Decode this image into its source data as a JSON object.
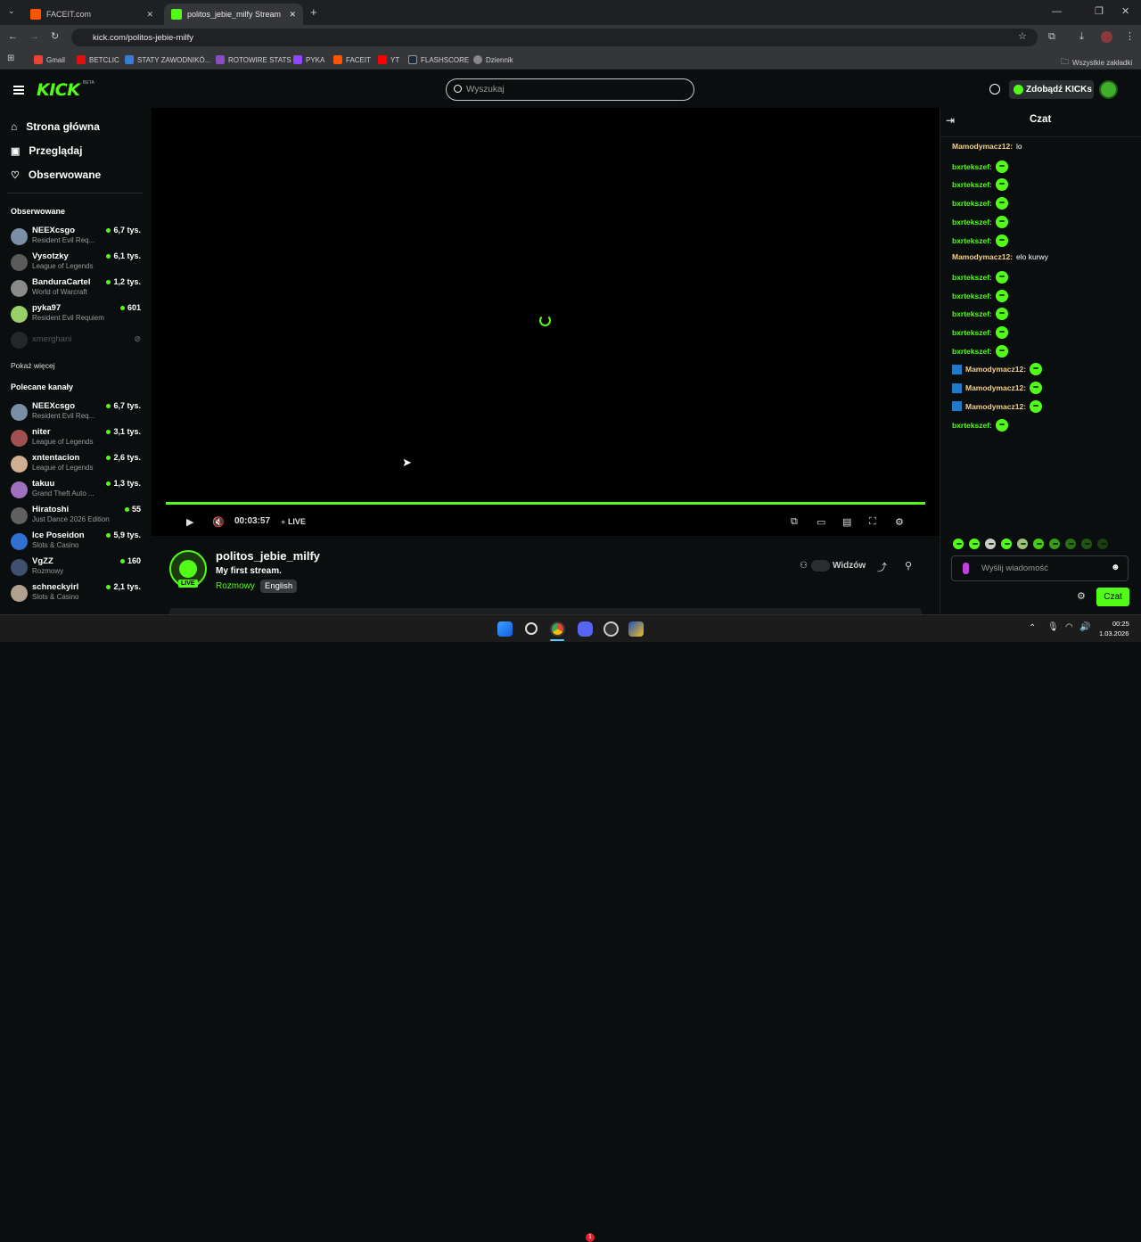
{
  "browser": {
    "tabs": [
      {
        "label": "FACEIT.com"
      },
      {
        "label": "politos_jebie_milfy Stream - Wa"
      }
    ],
    "url": "kick.com/politos-jebie-milfy",
    "bookmarks": [
      "Gmail",
      "BETCLIC",
      "STATY ZAWODNIKÓ...",
      "ROTOWIRE STATS",
      "PYKA",
      "FACEIT",
      "YT",
      "FLASHSCORE",
      "Dziennik"
    ],
    "all_bookmarks": "Wszystkie zakładki"
  },
  "header": {
    "logo": "KICK",
    "logo_beta": "BETA",
    "search_placeholder": "Wyszukaj",
    "get_kicks": "Zdobądź KICKs"
  },
  "sidebar": {
    "nav": [
      {
        "label": "Strona główna"
      },
      {
        "label": "Przeglądaj"
      },
      {
        "label": "Obserwowane"
      }
    ],
    "followed_heading": "Obserwowane",
    "followed": [
      {
        "name": "NEEXcsgo",
        "game": "Resident Evil Req...",
        "viewers": "6,7 tys.",
        "color": "#7a8fa6"
      },
      {
        "name": "Vysotzky",
        "game": "League of Legends",
        "viewers": "6,1 tys.",
        "color": "#5a5a5a"
      },
      {
        "name": "BanduraCartel",
        "game": "World of Warcraft",
        "viewers": "1,2 tys.",
        "color": "#8a8a8a"
      },
      {
        "name": "pyka97",
        "game": "Resident Evil Requiem",
        "viewers": "601",
        "color": "#9ad06a"
      },
      {
        "name": "xmerghani",
        "game": "",
        "viewers": "",
        "color": "#444"
      }
    ],
    "show_more": "Pokaż więcej",
    "recommended_heading": "Polecane kanały",
    "recommended": [
      {
        "name": "NEEXcsgo",
        "game": "Resident Evil Req...",
        "viewers": "6,7 tys.",
        "color": "#7a8fa6"
      },
      {
        "name": "niter",
        "game": "League of Legends",
        "viewers": "3,1 tys.",
        "color": "#a05050"
      },
      {
        "name": "xntentacion",
        "game": "League of Legends",
        "viewers": "2,6 tys.",
        "color": "#d0b090"
      },
      {
        "name": "takuu",
        "game": "Grand Theft Auto ...",
        "viewers": "1,3 tys.",
        "color": "#a070c0"
      },
      {
        "name": "Hiratoshi",
        "game": "Just Dance 2026 Edition",
        "viewers": "55",
        "color": "#606060"
      },
      {
        "name": "Ice Poseidon",
        "game": "Slots & Casino",
        "viewers": "5,9 tys.",
        "color": "#3070d0"
      },
      {
        "name": "VgZZ",
        "game": "Rozmowy",
        "viewers": "160",
        "color": "#405070"
      },
      {
        "name": "schneckyirl",
        "game": "Slots & Casino",
        "viewers": "2,1 tys.",
        "color": "#b0a090"
      }
    ]
  },
  "player": {
    "time": "00:03:57",
    "live": "LIVE",
    "progress": 1.0
  },
  "stream": {
    "channel": "politos_jebie_milfy",
    "title": "My first stream.",
    "category": "Rozmowy",
    "tag": "English",
    "live_badge": "LIVE",
    "viewers_label": "Widzów"
  },
  "chat": {
    "title": "Czat",
    "messages": [
      {
        "user": "Mamodymacz12:",
        "text": "lo",
        "style": "u1"
      },
      {
        "user": "bxrtekszef:",
        "text": "",
        "style": "u2"
      },
      {
        "user": "bxrtekszef:",
        "text": "",
        "style": "u2"
      },
      {
        "user": "bxrtekszef:",
        "text": "",
        "style": "u2"
      },
      {
        "user": "bxrtekszef:",
        "text": "",
        "style": "u2"
      },
      {
        "user": "bxrtekszef:",
        "text": "",
        "style": "u2"
      },
      {
        "user": "Mamodymacz12:",
        "text": "elo kurwy",
        "style": "u1"
      },
      {
        "user": "bxrtekszef:",
        "text": "",
        "style": "u2"
      },
      {
        "user": "bxrtekszef:",
        "text": "",
        "style": "u2"
      },
      {
        "user": "bxrtekszef:",
        "text": "",
        "style": "u2"
      },
      {
        "user": "bxrtekszef:",
        "text": "",
        "style": "u2"
      },
      {
        "user": "bxrtekszef:",
        "text": "",
        "style": "u2"
      },
      {
        "user": "Mamodymacz12:",
        "text": "",
        "style": "u3"
      },
      {
        "user": "Mamodymacz12:",
        "text": "",
        "style": "u3"
      },
      {
        "user": "Mamodymacz12:",
        "text": "",
        "style": "u3"
      },
      {
        "user": "bxrtekszef:",
        "text": "",
        "style": "u2"
      }
    ],
    "input_placeholder": "Wyślij wiadomość",
    "send_label": "Czat"
  },
  "taskbar": {
    "time": "00:25",
    "date": "1.03.2026",
    "notification_count": "1"
  }
}
